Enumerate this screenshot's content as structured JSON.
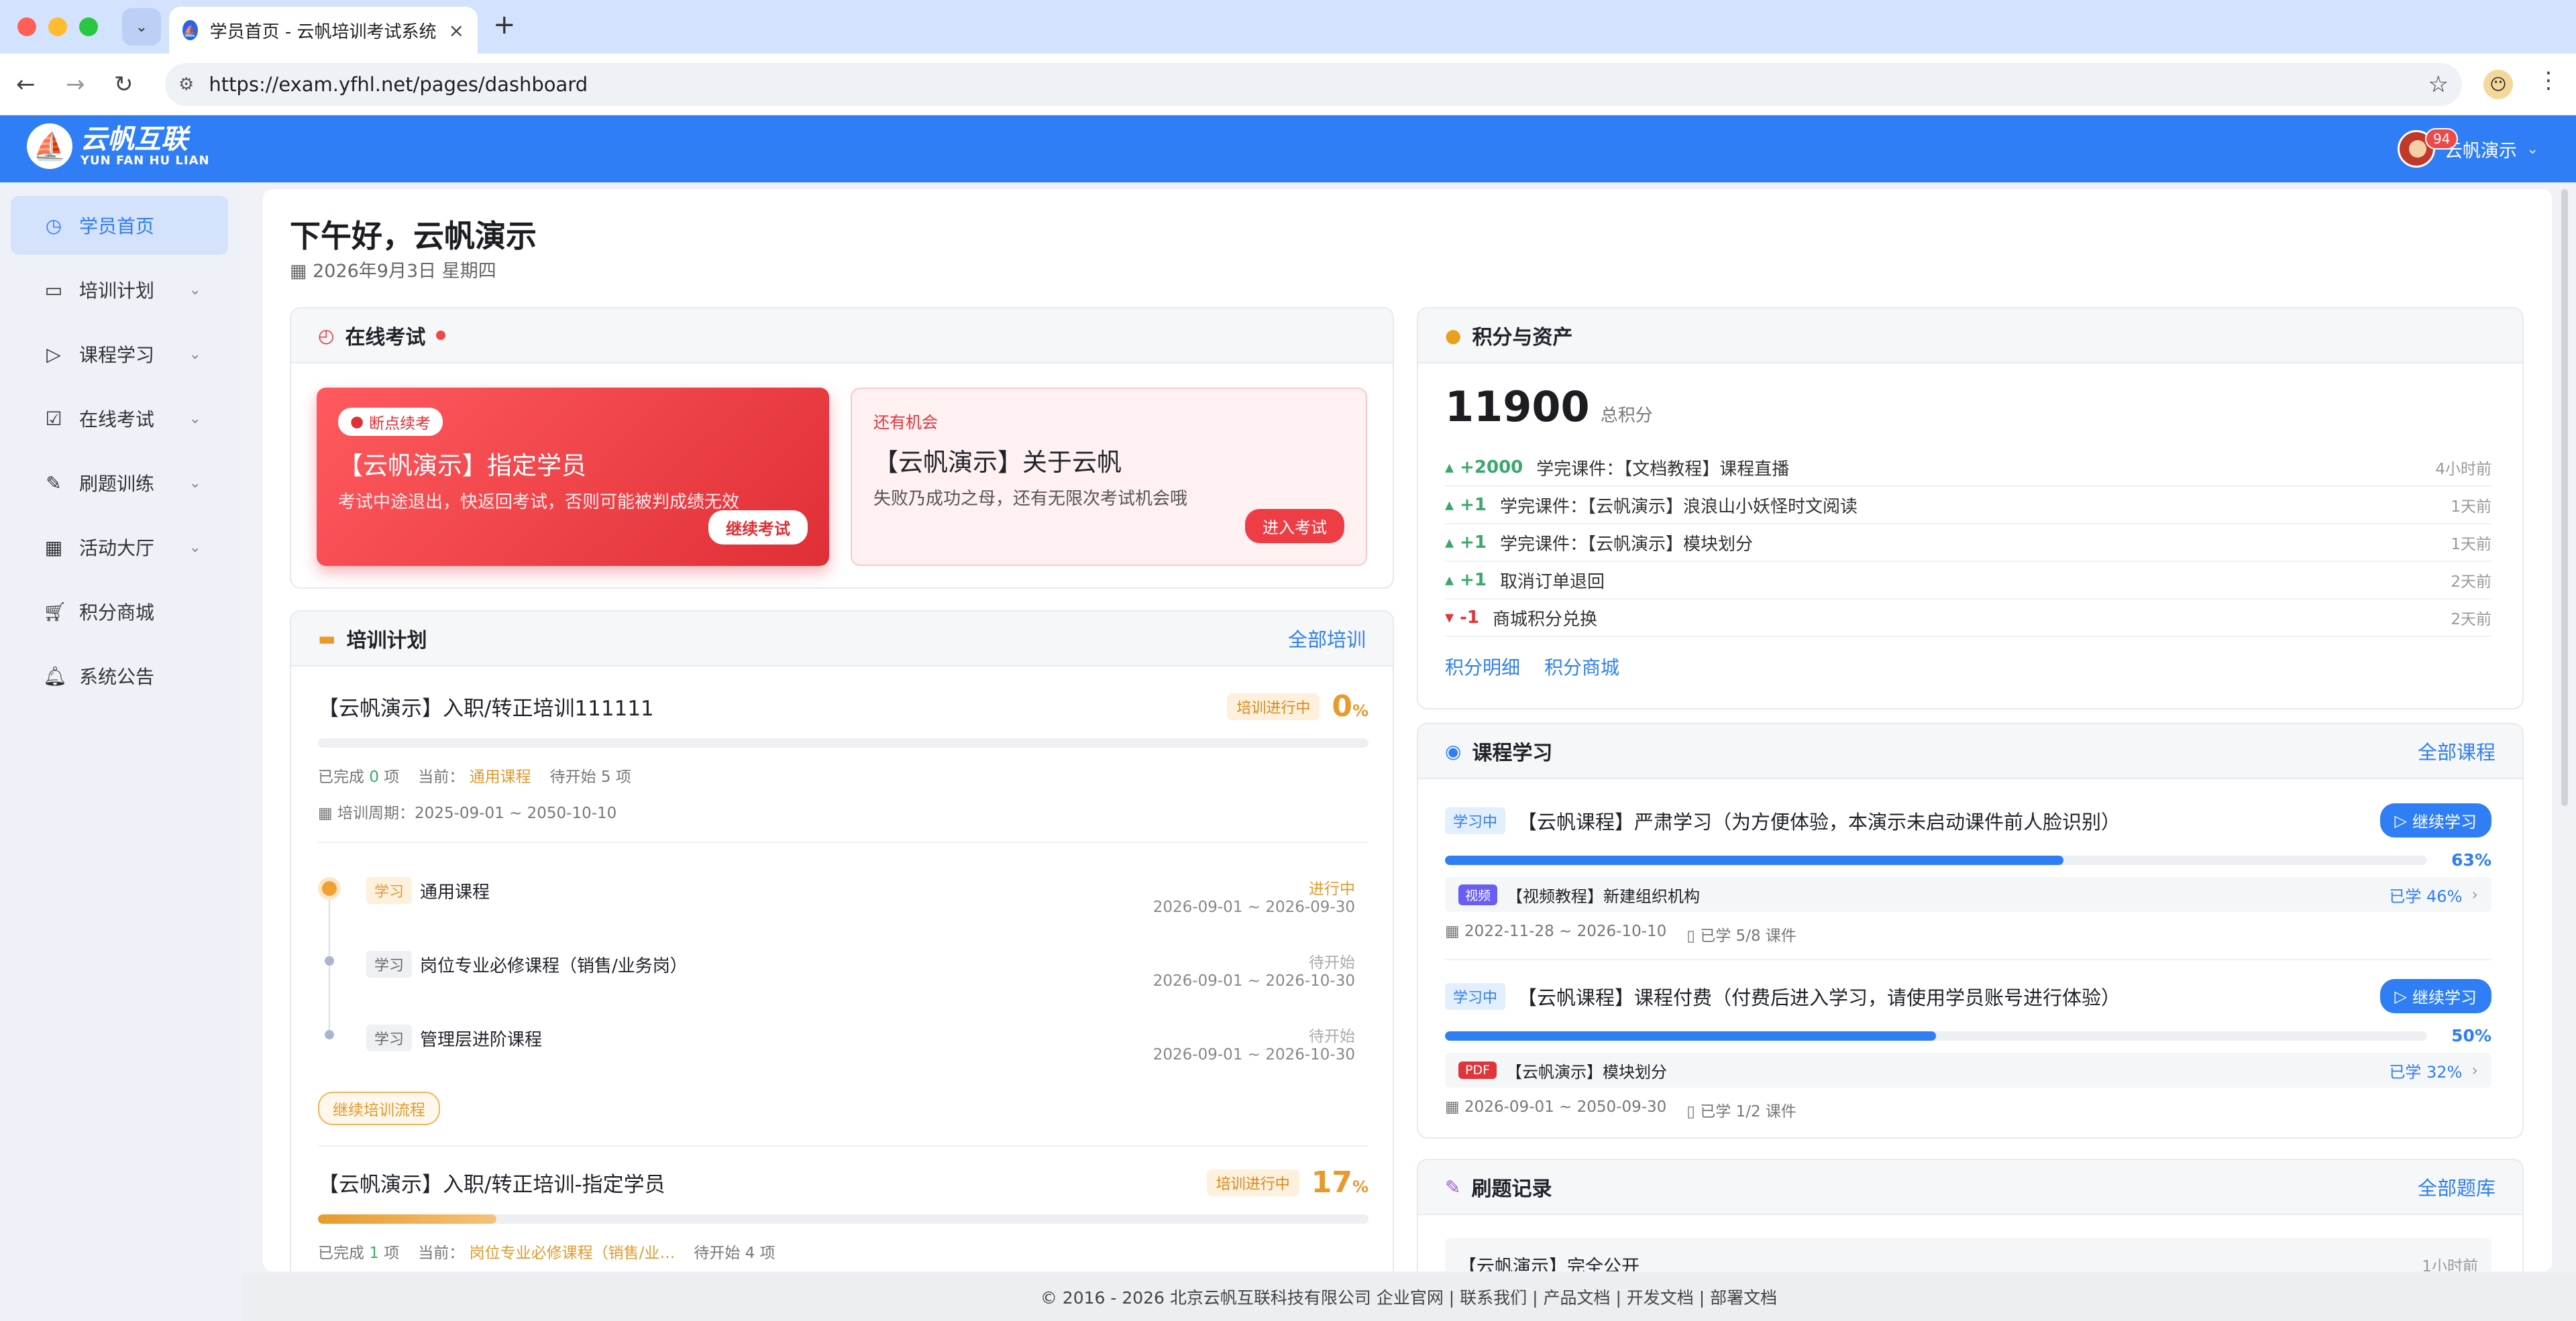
{
  "browser": {
    "tab_title": "学员首页 - 云帆培训考试系统",
    "url": "https://exam.yfhl.net/pages/dashboard"
  },
  "app": {
    "logo_cn": "云帆互联",
    "logo_en": "YUN FAN HU LIAN",
    "user_name": "云帆演示",
    "notif_count": "94"
  },
  "sidebar": {
    "items": [
      {
        "label": "学员首页",
        "icon": "dashboard-icon"
      },
      {
        "label": "培训计划",
        "icon": "book-icon"
      },
      {
        "label": "课程学习",
        "icon": "play-icon"
      },
      {
        "label": "在线考试",
        "icon": "exam-icon"
      },
      {
        "label": "刷题训练",
        "icon": "pen-icon"
      },
      {
        "label": "活动大厅",
        "icon": "calendar-icon"
      },
      {
        "label": "积分商城",
        "icon": "cart-icon"
      },
      {
        "label": "系统公告",
        "icon": "bell-icon"
      }
    ]
  },
  "main": {
    "greeting": "下午好，云帆演示",
    "date": "2026年9月3日 星期四"
  },
  "exam": {
    "title": "在线考试",
    "resume": {
      "tag": "断点续考",
      "title": "【云帆演示】指定学员",
      "desc": "考试中途退出，快返回考试，否则可能被判成绩无效",
      "button": "继续考试"
    },
    "retry": {
      "tag": "还有机会",
      "title": "【云帆演示】关于云帆",
      "desc": "失败乃成功之母，还有无限次考试机会哦",
      "button": "进入考试"
    }
  },
  "training": {
    "title": "培训计划",
    "more": "全部培训",
    "plans": [
      {
        "title": "【云帆演示】入职/转正培训111111",
        "status": "培训进行中",
        "percent": "0",
        "progress": 0,
        "done_label": "已完成",
        "done_count": "0",
        "item_unit": "项",
        "current_label": "当前：",
        "current": "通用课程",
        "pending_label": "待开始",
        "pending_count": "5",
        "period": "培训周期：2025-09-01 ~ 2050-10-10"
      },
      {
        "title": "【云帆演示】入职/转正培训-指定学员",
        "status": "培训进行中",
        "percent": "17",
        "progress": 0.17,
        "done_label": "已完成",
        "done_count": "1",
        "item_unit": "项",
        "current_label": "当前：",
        "current": "岗位专业必修课程（销售/业…",
        "pending_label": "待开始",
        "pending_count": "4"
      }
    ],
    "steps": [
      {
        "tag": "学习",
        "name": "通用课程",
        "status": "进行中",
        "dates": "2026-09-01 ~ 2026-09-30"
      },
      {
        "tag": "学习",
        "name": "岗位专业必修课程（销售/业务岗）",
        "status": "待开始",
        "dates": "2026-09-01 ~ 2026-10-30"
      },
      {
        "tag": "学习",
        "name": "管理层进阶课程",
        "status": "待开始",
        "dates": "2026-09-01 ~ 2026-10-30"
      }
    ],
    "continue_button": "继续培训流程"
  },
  "points": {
    "title": "积分与资产",
    "total": "11900",
    "total_label": "总积分",
    "records": [
      {
        "amount": "+2000",
        "desc": "学完课件：【文档教程】课程直播",
        "time": "4小时前",
        "dir": "up"
      },
      {
        "amount": "+1",
        "desc": "学完课件：【云帆演示】浪浪山小妖怪时文阅读",
        "time": "1天前",
        "dir": "up"
      },
      {
        "amount": "+1",
        "desc": "学完课件：【云帆演示】模块划分",
        "time": "1天前",
        "dir": "up"
      },
      {
        "amount": "+1",
        "desc": "取消订单退回",
        "time": "2天前",
        "dir": "up"
      },
      {
        "amount": "-1",
        "desc": "商城积分兑换",
        "time": "2天前",
        "dir": "down"
      }
    ],
    "link_detail": "积分明细",
    "link_mall": "积分商城"
  },
  "courses": {
    "title": "课程学习",
    "more": "全部课程",
    "items": [
      {
        "tag": "学习中",
        "title": "【云帆课程】严肃学习（为方便体验，本演示未启动课件前人脸识别）",
        "button": "继续学习",
        "percent": "63%",
        "progress": 0.63,
        "sub_type": "视频",
        "sub_title": "【视频教程】新建组织机构",
        "sub_learned": "已学 46%",
        "dates": "2022-11-28 ~ 2026-10-10",
        "count": "已学 5/8 课件"
      },
      {
        "tag": "学习中",
        "title": "【云帆课程】课程付费（付费后进入学习，请使用学员账号进行体验）",
        "button": "继续学习",
        "percent": "50%",
        "progress": 0.5,
        "sub_type": "PDF",
        "sub_title": "【云帆演示】模块划分",
        "sub_learned": "已学 32%",
        "dates": "2026-09-01 ~ 2050-09-30",
        "count": "已学 1/2 课件"
      }
    ]
  },
  "practice": {
    "title": "刷题记录",
    "more": "全部题库",
    "first_item": "【云帆演示】完全公开",
    "first_time": "1小时前"
  },
  "footer": {
    "text": "© 2016 - 2026 北京云帆互联科技有限公司 企业官网 | 联系我们 | 产品文档 | 开发文档 | 部署文档"
  },
  "colors": {
    "primary": "#2f7ef5",
    "danger": "#e0353c",
    "warning": "#e89a2c",
    "success": "#3aa86b"
  }
}
